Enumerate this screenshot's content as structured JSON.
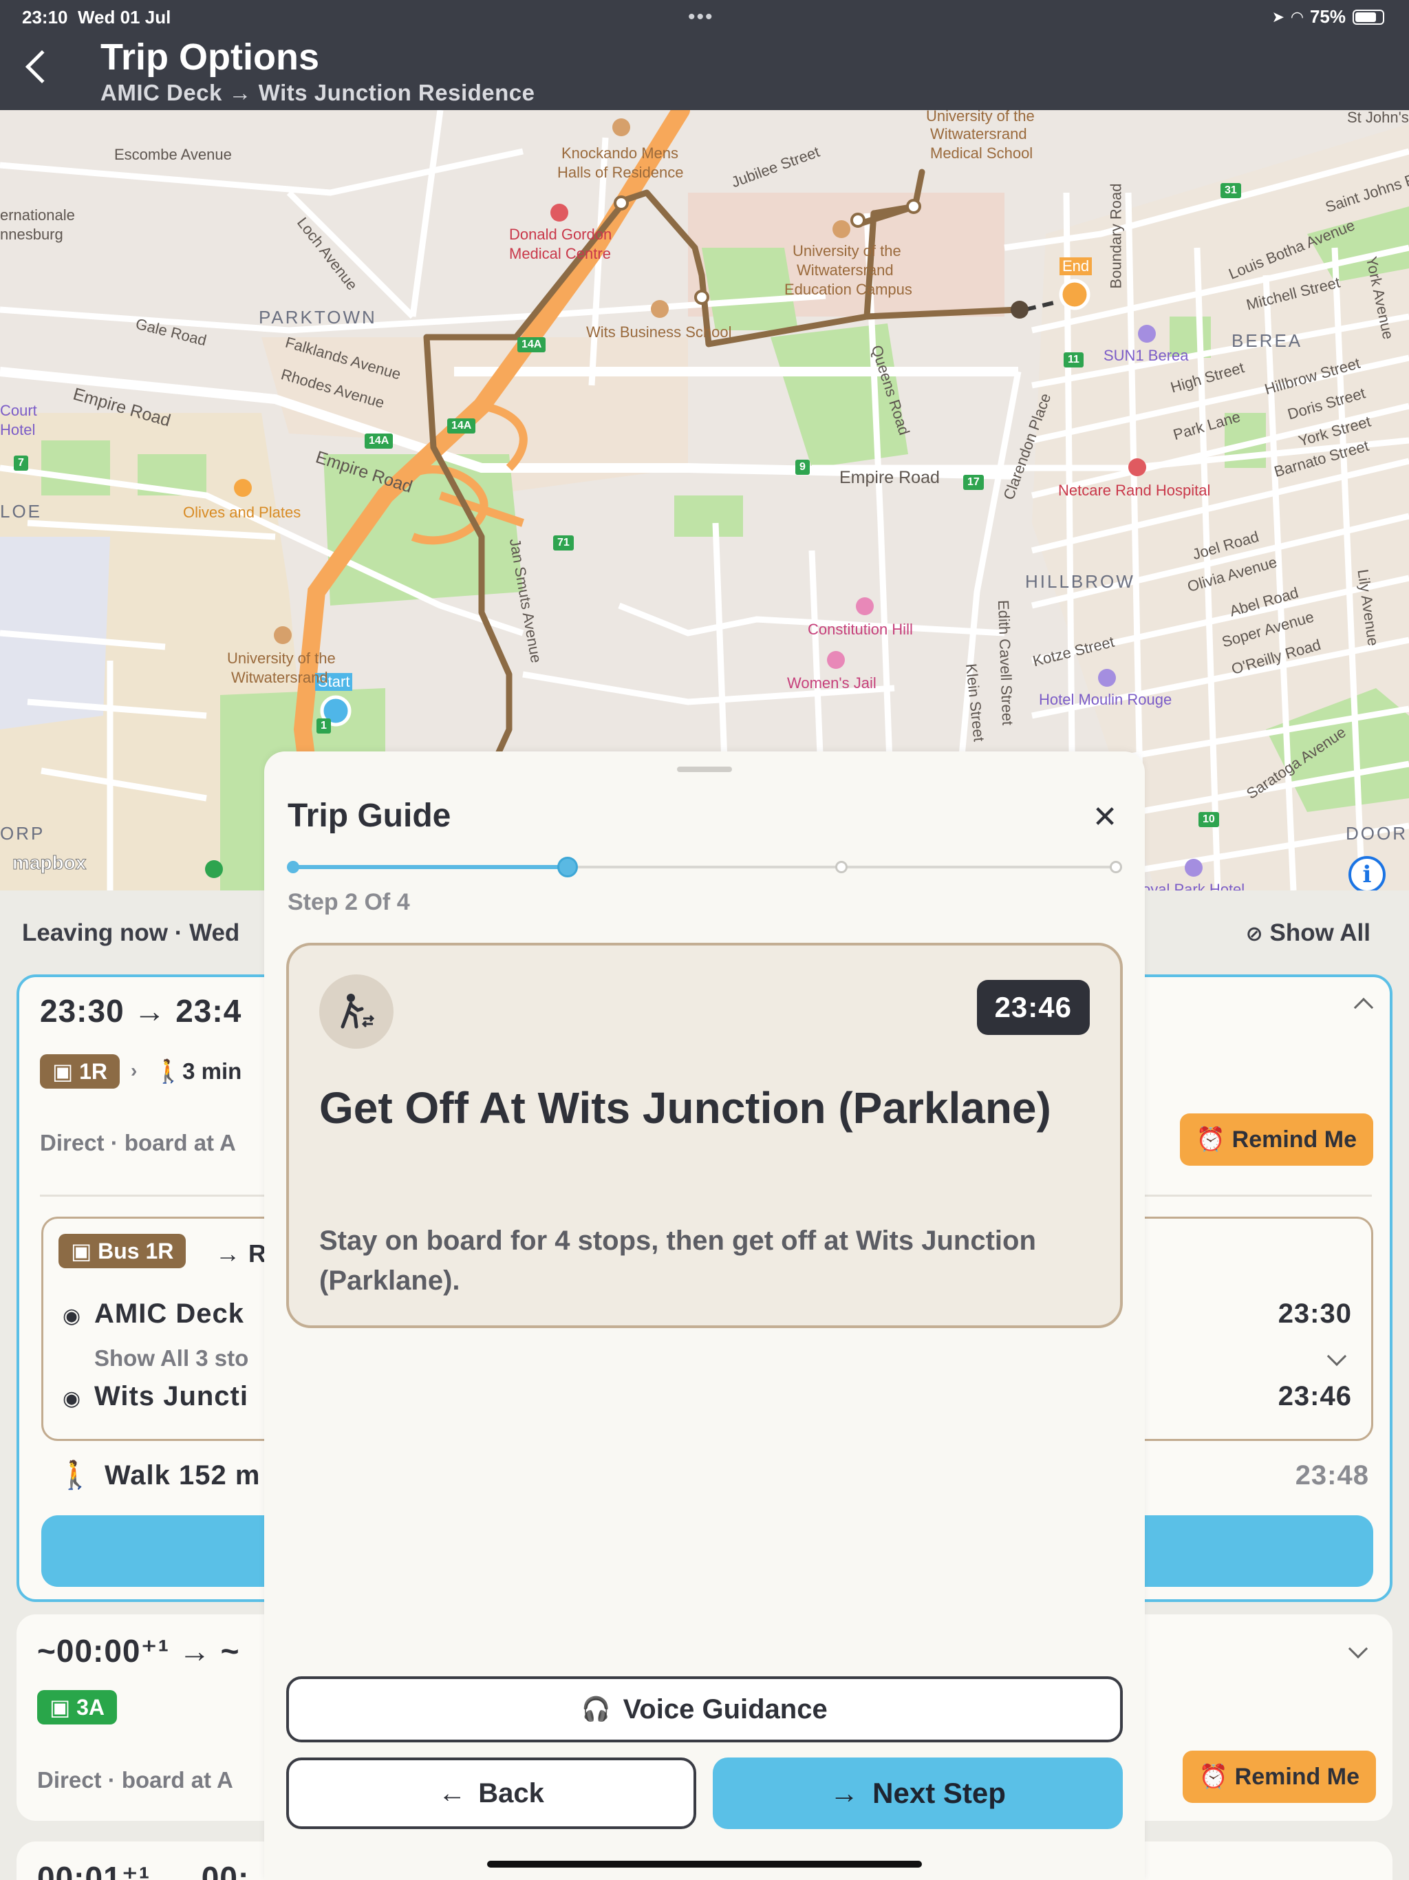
{
  "status_bar": {
    "time": "23:10",
    "date": "Wed 01 Jul",
    "battery": "75%",
    "dots": "•••"
  },
  "header": {
    "title": "Trip Options",
    "subtitle": "AMIC Deck → Wits Junction Residence"
  },
  "map": {
    "labels": {
      "escombe": "Escombe Avenue",
      "internationale": "ernationale",
      "nnesburg": "nnesburg",
      "loch": "Loch Avenue",
      "parktown": "PARKTOWN",
      "gale": "Gale Road",
      "falklands": "Falklands Avenue",
      "rhodes": "Rhodes Avenue",
      "empire_w": "Empire Road",
      "empire_mid": "Empire Road",
      "empire_e": "Empire Road",
      "court": "Court",
      "hotel": "Hotel",
      "loe": "LOE",
      "olives": "Olives and Plates",
      "knockando": "Knockando Mens",
      "halls": "Halls of Residence",
      "donald": "Donald Gordon",
      "medical": "Medical Centre",
      "jubilee": "Jubilee Street",
      "uni_med1": "University of the",
      "uni_med2": "Witwatersrand",
      "uni_med3": "Medical School",
      "uni_edu1": "University of the",
      "uni_edu2": "Witwatersrand",
      "uni_edu3": "Education Campus",
      "wbs": "Wits Business School",
      "queens": "Queens Road",
      "boundary": "Boundary Road",
      "clarendon": "Clarendon Place",
      "end": "End",
      "start": "Start",
      "stjohns": "St John's",
      "saintjohns": "Saint Johns R",
      "louis": "Louis Botha Avenue",
      "york": "York Avenue",
      "mitchell": "Mitchell Street",
      "berea": "BEREA",
      "sun1": "SUN1 Berea",
      "high": "High Street",
      "hillbrow_st": "Hillbrow Street",
      "doris": "Doris Street",
      "park_lane": "Park Lane",
      "york_st": "York Street",
      "barnato": "Barnato Street",
      "netcare": "Netcare Rand Hospital",
      "joel": "Joel Road",
      "olivia": "Olivia Avenue",
      "abel": "Abel Road",
      "soper": "Soper Avenue",
      "oreilly": "O'Reilly Road",
      "lily": "Lily Avenue",
      "hillbrow": "HILLBROW",
      "constitution": "Constitution Hill",
      "womens": "Women's Jail",
      "kotze": "Kotze Street",
      "moulin": "Hotel Moulin Rouge",
      "edith": "Edith Cavell Street",
      "klein": "Klein Street",
      "saratoga": "Saratoga Avenue",
      "uni_main1": "University of the",
      "uni_main2": "Witwatersrand",
      "orp": "ORP",
      "doorn": "DOORI",
      "royal": "oyal Park Hotel",
      "jan_smuts": "Jan Smuts Avenue"
    },
    "shields": [
      "14A",
      "14A",
      "14A",
      "7",
      "9",
      "17",
      "71",
      "11",
      "31",
      "10",
      "1"
    ],
    "attribution": "mapbox",
    "info": "i"
  },
  "list": {
    "leaving": "Leaving now · Wed",
    "show_all": "Show All",
    "card1": {
      "times": "23:30 → 23:4",
      "route_badge": "1R",
      "walk": "3 min",
      "direct": "Direct · board at A",
      "remind": "Remind Me",
      "bus_badge": "Bus 1R",
      "bus_dir": "→ R",
      "stop1": "AMIC Deck",
      "stop1_time": "23:30",
      "show_stops": "Show All 3 sto",
      "stop2": "Wits Juncti",
      "stop2_time": "23:46",
      "walk_line": "Walk 152 m",
      "walk_time": "23:48"
    },
    "card2": {
      "times": "~00:00⁺¹ → ~",
      "route_badge": "3A",
      "direct": "Direct · board at A",
      "remind": "Remind Me"
    },
    "card3": {
      "times": "00:01⁺¹ → 00:"
    }
  },
  "sheet": {
    "title": "Trip Guide",
    "close": "✕",
    "step_label": "Step 2 Of 4",
    "progress": 0.333,
    "steps_total": 4,
    "current_step": 2,
    "time": "23:46",
    "heading": "Get Off At Wits Junction (Parklane)",
    "body": "Stay on board for 4 stops, then get off at Wits Junction (Parklane).",
    "voice": "Voice Guidance",
    "back": "Back",
    "next": "Next Step"
  },
  "colors": {
    "header": "#3b3e47",
    "accent_blue": "#5ac0e7",
    "route_brown": "#8c6b45",
    "remind_orange": "#f6a742",
    "highway_orange": "#f7a85a"
  }
}
